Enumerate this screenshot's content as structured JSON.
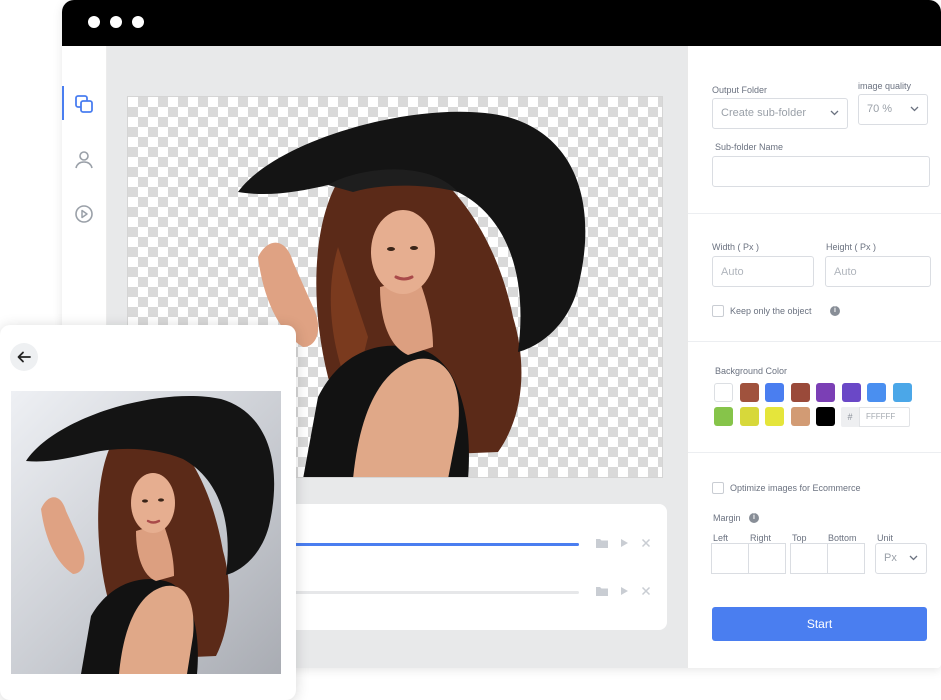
{
  "window": {
    "title_dots": 3,
    "nav": [
      {
        "icon": "layers-icon"
      },
      {
        "icon": "user-edit-icon"
      },
      {
        "icon": "play-circle-icon"
      }
    ]
  },
  "queue": {
    "rows": [
      {
        "progress": 1.0,
        "icons": [
          "folder-icon",
          "play-icon",
          "close-icon"
        ]
      },
      {
        "progress": 0.0,
        "icons": [
          "folder-icon",
          "play-icon",
          "close-icon"
        ]
      }
    ]
  },
  "settings": {
    "output_folder_label": "Output Folder",
    "output_folder_value": "Create sub-folder",
    "image_quality_label": "image quality",
    "image_quality_value": "70 %",
    "subfolder_label": "Sub-folder Name",
    "subfolder_value": "",
    "width_label": "Width ( Px )",
    "width_placeholder": "Auto",
    "height_label": "Height ( Px )",
    "height_placeholder": "Auto",
    "keep_object_label": "Keep only the object",
    "background_color_label": "Background Color",
    "colors": [
      "#ffffff",
      "#a0523d",
      "#4a7ef0",
      "#9a4a3a",
      "#7b3fb5",
      "#6a48c7",
      "#4a8ff0",
      "#4ba7e8",
      "#86c44a",
      "#d7d83a",
      "#e5e53b",
      "#d29b74",
      "#000000"
    ],
    "hex_prefix": "#",
    "hex_value": "FFFFFF",
    "optimize_label": "Optimize images for Ecommerce",
    "margin_label": "Margin",
    "margin_left": "Left",
    "margin_right": "Right",
    "margin_top": "Top",
    "margin_bottom": "Bottom",
    "unit_label": "Unit",
    "unit_value": "Px",
    "start_label": "Start"
  }
}
